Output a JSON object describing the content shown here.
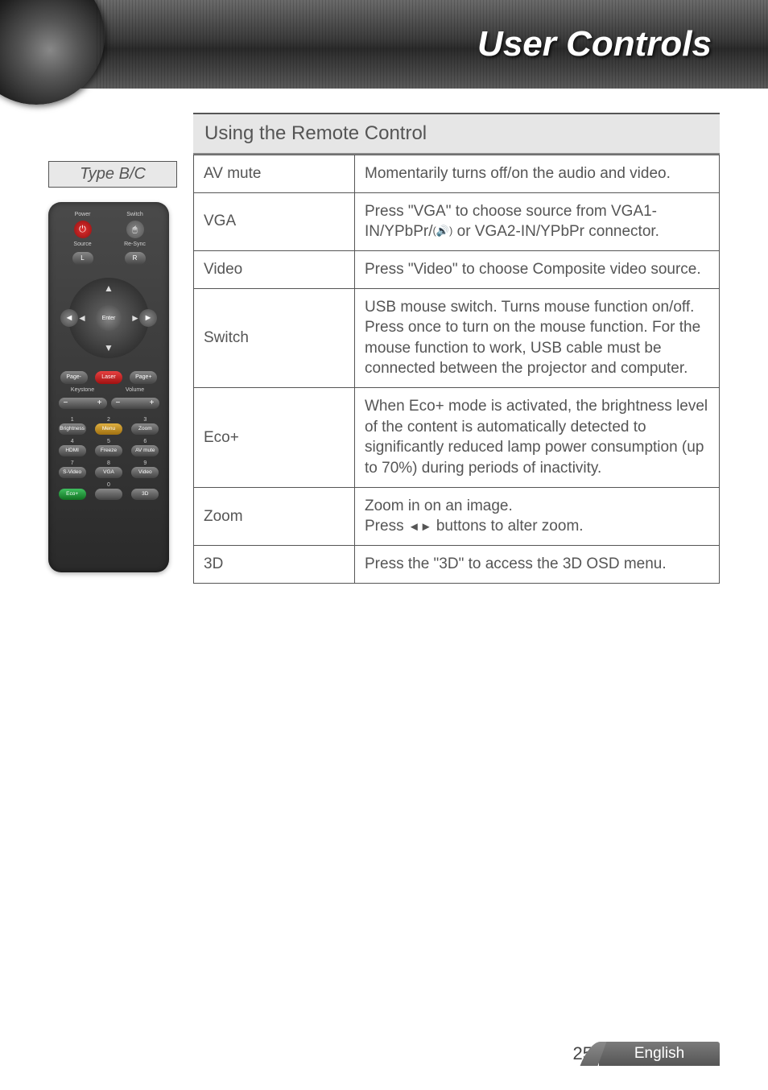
{
  "header": {
    "title": "User Controls"
  },
  "sidebar": {
    "type_label": "Type B/C",
    "remote": {
      "top_row": {
        "power": "Power",
        "switch": "Switch"
      },
      "second_row": {
        "source": "Source",
        "resync": "Re-Sync"
      },
      "lr": {
        "left": "L",
        "right": "R"
      },
      "dpad": {
        "enter": "Enter"
      },
      "page_row": {
        "page_minus": "Page-",
        "laser": "Laser",
        "page_plus": "Page+"
      },
      "rocker_labels": {
        "keystone": "Keystone",
        "volume": "Volume"
      },
      "keypad": {
        "n1": "1",
        "b1": "Brightness",
        "n2": "2",
        "b2": "Menu",
        "n3": "3",
        "b3": "Zoom",
        "n4": "4",
        "b4": "HDMI",
        "n5": "5",
        "b5": "Freeze",
        "n6": "6",
        "b6": "AV mute",
        "n7": "7",
        "b7": "S-Video",
        "n8": "8",
        "b8": "VGA",
        "n9": "9",
        "b9": "Video",
        "n0": "0",
        "eco": "Eco+",
        "threeD": "3D"
      }
    }
  },
  "section": {
    "title": "Using the Remote Control"
  },
  "rows": {
    "avmute": {
      "name": "AV mute",
      "desc": "Momentarily turns off/on the audio and video."
    },
    "vga": {
      "name": "VGA",
      "desc_a": "Press \"VGA\" to choose source from VGA1-IN/YPbPr/",
      "desc_b": " or VGA2-IN/YPbPr connector."
    },
    "video": {
      "name": "Video",
      "desc": "Press \"Video\" to choose Composite video source."
    },
    "switch": {
      "name": "Switch",
      "desc": "USB mouse switch. Turns mouse function on/off. Press once to turn on the mouse function.  For the mouse function to work, USB cable must be connected between the projector and computer."
    },
    "eco": {
      "name": "Eco+",
      "desc": "When Eco+ mode is activated, the brightness level of the content is automatically detected to significantly reduced lamp power consumption (up to 70%) during periods of inactivity."
    },
    "zoom": {
      "name": "Zoom",
      "line1": "Zoom in on an image.",
      "line2a": "Press ",
      "line2b": " buttons to alter zoom."
    },
    "threeD": {
      "name": "3D",
      "desc": "Press the \"3D\" to access the 3D OSD menu."
    }
  },
  "footer": {
    "page": "25",
    "lang": "English"
  },
  "glyphs": {
    "left_tri": "◄",
    "right_tri": "►",
    "audio": "((🔊))"
  }
}
